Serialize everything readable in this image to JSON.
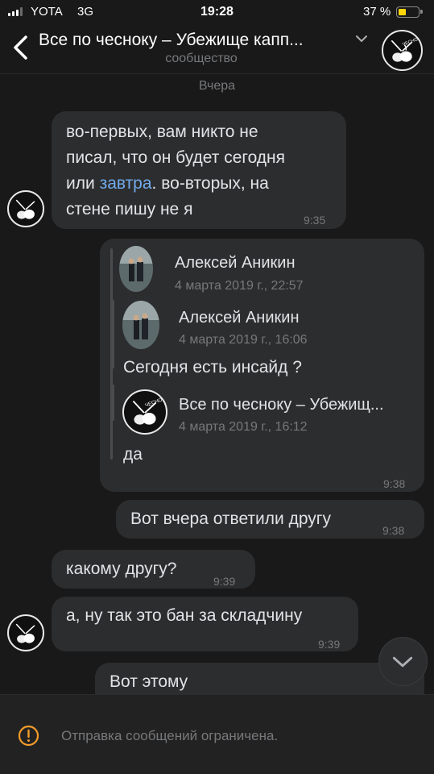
{
  "status_bar": {
    "carrier": "YOTA",
    "network": "3G",
    "time": "19:28",
    "battery": "37 %",
    "battery_level": 0.37
  },
  "header": {
    "title": "Все по чесноку – Убежище капп...",
    "subtitle": "сообщество",
    "avatar_icon": "garlic-logo-icon"
  },
  "date_separator": "Вчера",
  "messages": [
    {
      "lines": [
        "во-первых, вам никто не",
        "писал, что он будет сегодня"
      ],
      "line3_pre": "или ",
      "line3_link": "завтра",
      "line3_post": ". во-вторых, на",
      "line4": "стене пишу не я",
      "time": "9:35"
    },
    {
      "forward": {
        "name": "Алексей Аникин",
        "date": "4 марта 2019 г., 22:57",
        "nested": {
          "name": "Алексей Аникин",
          "date": "4 марта 2019 г., 16:06",
          "text": "Сегодня есть инсайд ?",
          "nested": {
            "name": "Все по чесноку – Убежищ...",
            "date": "4 марта 2019 г., 16:12"
          }
        },
        "text": "да"
      },
      "time": "9:38"
    },
    {
      "text": "Вот вчера ответили другу",
      "time": "9:38"
    },
    {
      "text": "какому другу?",
      "time": "9:39"
    },
    {
      "text": "а, ну так это бан за складчину",
      "time": "9:39"
    },
    {
      "text": "Вот этому"
    }
  ],
  "composer": {
    "restricted_text": "Отправка сообщений ограничена."
  },
  "colors": {
    "background": "#19191a",
    "bubble": "#2c2d2e",
    "link": "#71aaeb",
    "secondary_text": "#76787a",
    "warning": "#f39b2a"
  }
}
